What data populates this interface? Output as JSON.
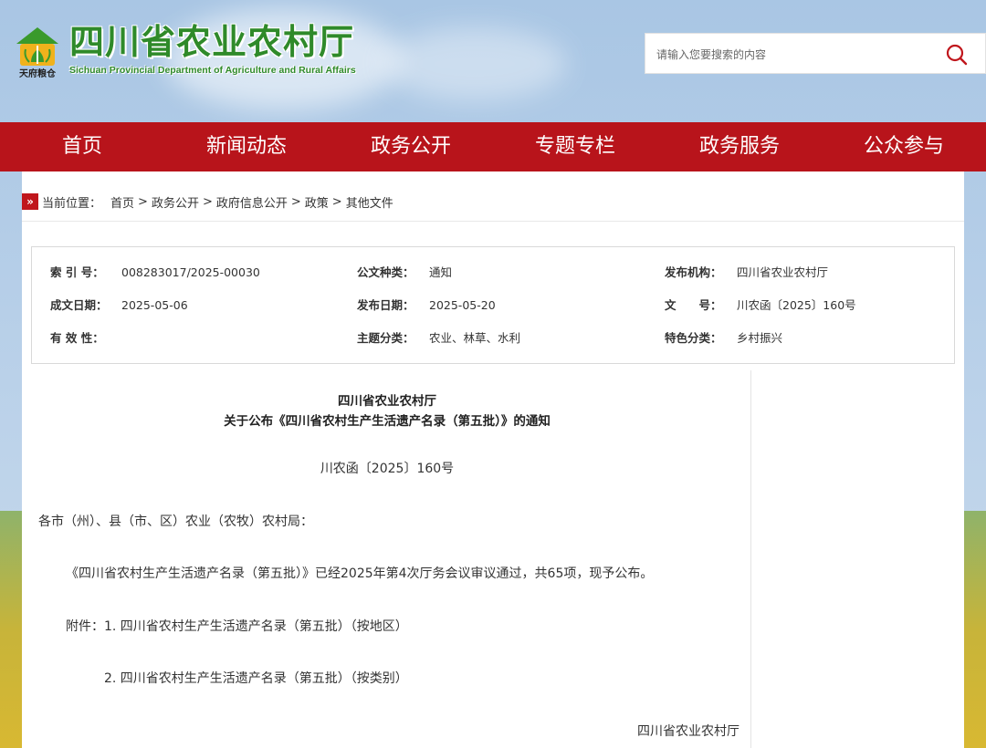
{
  "header": {
    "title": "四川省农业农村厅",
    "subtitle": "Sichuan Provincial Department of Agriculture and Rural Affairs",
    "logo_caption": "天府粮仓",
    "logo_icon": "wheat-grain-logo-icon"
  },
  "search": {
    "placeholder": "请输入您要搜索的内容",
    "icon": "search-icon",
    "accent": "#c0161c"
  },
  "nav": {
    "background": "#b8141b",
    "items": [
      {
        "label": "首页"
      },
      {
        "label": "新闻动态"
      },
      {
        "label": "政务公开"
      },
      {
        "label": "专题专栏"
      },
      {
        "label": "政务服务"
      },
      {
        "label": "公众参与"
      }
    ]
  },
  "breadcrumb": {
    "prefix": "当前位置：",
    "items": [
      "首页",
      "政务公开",
      "政府信息公开",
      "政策",
      "其他文件"
    ],
    "separator": ">"
  },
  "meta": {
    "index_label": "索 引 号：",
    "index_value": "008283017/2025-00030",
    "doctype_label": "公文种类：",
    "doctype_value": "通知",
    "publisher_label": "发布机构：",
    "publisher_value": "四川省农业农村厅",
    "created_label": "成文日期：",
    "created_value": "2025-05-06",
    "published_label": "发布日期：",
    "published_value": "2025-05-20",
    "docno_label": "文　　号：",
    "docno_value": "川农函〔2025〕160号",
    "validity_label": "有 效 性：",
    "validity_value": "",
    "topic_label": "主题分类：",
    "topic_value": "农业、林草、水利",
    "feature_label": "特色分类：",
    "feature_value": "乡村振兴"
  },
  "article": {
    "title_line1": "四川省农业农村厅",
    "title_line2": "关于公布《四川省农村生产生活遗产名录（第五批）》的通知",
    "doc_number": "川农函〔2025〕160号",
    "salutation": "各市（州）、县（市、区）农业（农牧）农村局：",
    "body": "《四川省农村生产生活遗产名录（第五批）》已经2025年第4次厅务会议审议通过，共65项，现予公布。",
    "attachment1": "附件：1. 四川省农村生产生活遗产名录（第五批）（按地区）",
    "attachment2": "2. 四川省农村生产生活遗产名录（第五批）（按类别）",
    "signature": "四川省农业农村厅"
  }
}
